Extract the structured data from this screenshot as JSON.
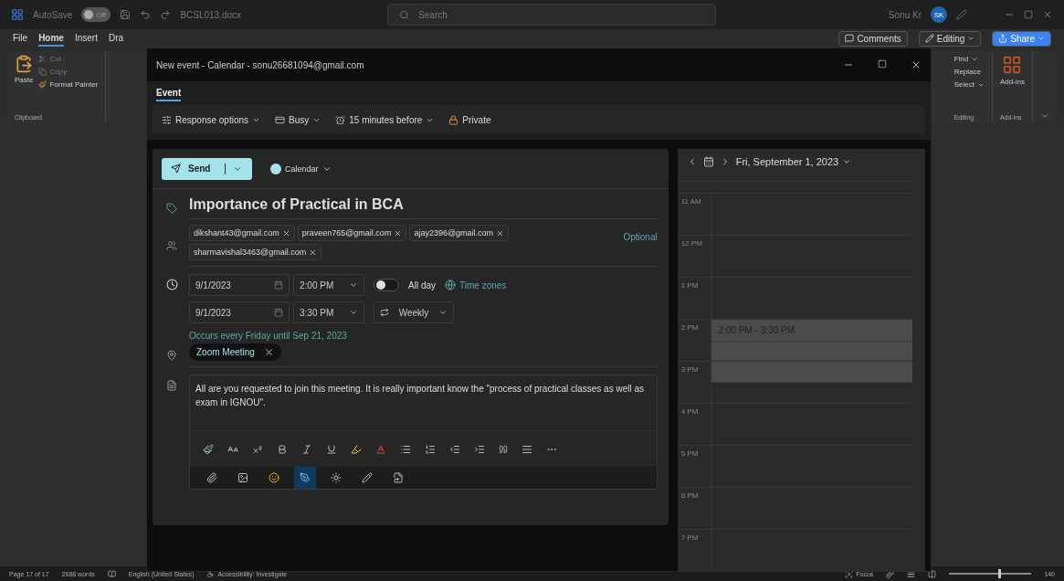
{
  "title_bar": {
    "autosave_label": "AutoSave",
    "autosave_on": false,
    "autosave_state": "Off",
    "file_name": "BCSL013.docx",
    "search_placeholder": "Search",
    "user_name": "Sonu Kr",
    "user_initials": "SK"
  },
  "ribbon_tabs": [
    {
      "label": "File",
      "selected": false
    },
    {
      "label": "Home",
      "selected": true
    },
    {
      "label": "Insert",
      "selected": false
    },
    {
      "label": "Dra",
      "selected": false
    }
  ],
  "ribbon_buttons": [
    {
      "kind": "comments",
      "label": "Comments"
    },
    {
      "kind": "editing",
      "label": "Editing"
    },
    {
      "kind": "share",
      "label": "Share"
    }
  ],
  "clipboard": {
    "paste": "Paste",
    "cut": "Cut",
    "copy": "Copy",
    "format_painter": "Format Painter",
    "group": "Clipboard"
  },
  "editing": {
    "find": "Find",
    "replace": "Replace",
    "select": "Select",
    "group": "Editing"
  },
  "addins": {
    "button": "Add-ins",
    "group": "Add-ins"
  },
  "dialog": {
    "title": "New event - Calendar - sonu26681094@gmail.com",
    "tabs": [
      {
        "label": "Event",
        "selected": true
      }
    ],
    "toolbar": [
      {
        "kind": "response",
        "label": "Response options"
      },
      {
        "kind": "busy",
        "label": "Busy"
      },
      {
        "kind": "reminder",
        "label": "15 minutes before"
      },
      {
        "kind": "private",
        "label": "Private"
      }
    ],
    "send_label": "Send",
    "calendar_label": "Calendar",
    "event_title": "Importance of Practical in BCA",
    "attendees": [
      "dikshant43@gmail.com",
      "praveen765@gmail.com",
      "ajay2396@gmail.com",
      "sharmavishal3463@gmail.com"
    ],
    "optional_label": "Optional",
    "start": {
      "date": "9/1/2023",
      "time": "2:00 PM"
    },
    "end": {
      "date": "9/1/2023",
      "time": "3:30 PM"
    },
    "all_day": {
      "label": "All day",
      "on": false
    },
    "time_zones": "Time zones",
    "repeat": "Weekly",
    "recurrence_note": "Occurs every Friday until Sep 21, 2023",
    "location": "Zoom Meeting",
    "body": "All are you requested to join this meeting. It is really important know the \"process of practical classes as well as exam in IGNOU\".",
    "insert_tools": [
      {
        "kind": "attach",
        "selected": false
      },
      {
        "kind": "image",
        "selected": false
      },
      {
        "kind": "emoji",
        "selected": false
      },
      {
        "kind": "draw",
        "selected": true
      },
      {
        "kind": "sun",
        "selected": false
      },
      {
        "kind": "pen",
        "selected": false
      },
      {
        "kind": "file",
        "selected": false
      }
    ],
    "calendar": {
      "date_label": "Fri, September 1, 2023",
      "hours": [
        {
          "label": "11 AM",
          "booked": [
            false,
            false
          ]
        },
        {
          "label": "12 PM",
          "booked": [
            false,
            false
          ]
        },
        {
          "label": "1 PM",
          "booked": [
            false,
            false
          ]
        },
        {
          "label": "2 PM",
          "booked": [
            true,
            true
          ],
          "event": "2:00 PM - 3:30 PM"
        },
        {
          "label": "3 PM",
          "booked": [
            true,
            false
          ]
        },
        {
          "label": "4 PM",
          "booked": [
            false,
            false
          ]
        },
        {
          "label": "5 PM",
          "booked": [
            false,
            false
          ]
        },
        {
          "label": "6 PM",
          "booked": [
            false,
            false
          ]
        },
        {
          "label": "7 PM",
          "booked": [
            false,
            false
          ]
        }
      ]
    }
  },
  "status_bar": {
    "page": "Page 17 of 17",
    "words": "2688 words",
    "language": "English (United States)",
    "accessibility": "Accessibility: Investigate",
    "focus": "Focus",
    "zoom_slider": {
      "level": 0.6
    },
    "zoom": "140"
  }
}
